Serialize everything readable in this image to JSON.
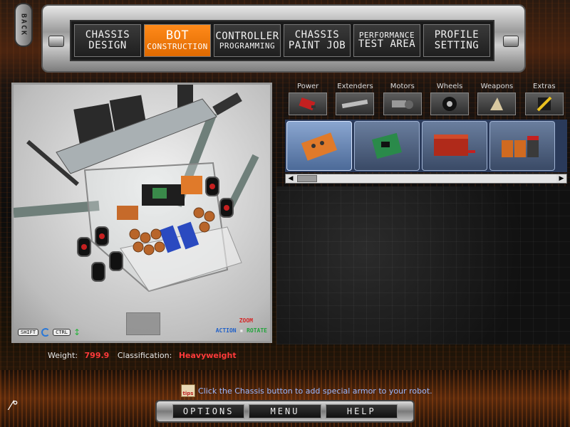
{
  "nav": {
    "back_label": "BACK",
    "tabs": [
      {
        "line1": "CHASSIS",
        "line2": "DESIGN",
        "active": false
      },
      {
        "line1": "BOT",
        "line2": "CONSTRUCTION",
        "active": true
      },
      {
        "line1": "CONTROLLER",
        "line2": "PROGRAMMING",
        "active": false
      },
      {
        "line1": "CHASSIS",
        "line2": "PAINT JOB",
        "active": false
      },
      {
        "line1": "PERFORMANCE",
        "line2": "TEST AREA",
        "active": false
      },
      {
        "line1": "PROFILE",
        "line2": "SETTING",
        "active": false
      }
    ]
  },
  "viewport": {
    "shift_key": "SHIFT",
    "ctrl_key": "CTRL",
    "zoom_label": "ZOOM",
    "action_label": "ACTION",
    "rotate_label": "ROTATE"
  },
  "stats": {
    "weight_label": "Weight:",
    "weight_value": "799.9",
    "classification_label": "Classification:",
    "classification_value": "Heavyweight"
  },
  "parts": {
    "categories": [
      {
        "label": "Power",
        "icon": "battery-icon"
      },
      {
        "label": "Extenders",
        "icon": "extender-bar-icon"
      },
      {
        "label": "Motors",
        "icon": "motor-icon"
      },
      {
        "label": "Wheels",
        "icon": "wheel-icon"
      },
      {
        "label": "Weapons",
        "icon": "weapon-icon"
      },
      {
        "label": "Extras",
        "icon": "extras-icon"
      }
    ],
    "items": [
      {
        "name": "orange-battery-pack-icon",
        "color": "#e07a2a",
        "selected": true
      },
      {
        "name": "green-circuit-board-icon",
        "color": "#2a8a4a",
        "selected": false
      },
      {
        "name": "red-battery-block-icon",
        "color": "#b02a1a",
        "selected": false
      },
      {
        "name": "battery-cluster-icon",
        "color": "#d06a20",
        "selected": false
      }
    ]
  },
  "tip": {
    "icon_label": "tips",
    "text": "Click the Chassis button to add special armor to your robot."
  },
  "bottom": {
    "options": "OPTIONS",
    "menu": "MENU",
    "help": "HELP"
  }
}
